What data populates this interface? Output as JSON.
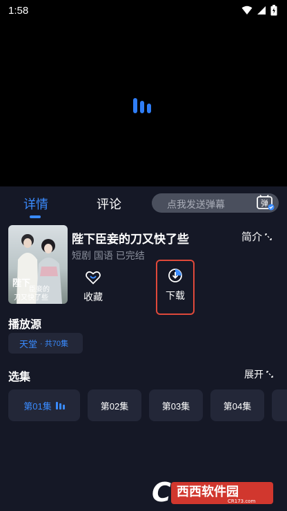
{
  "status_bar": {
    "time": "1:58"
  },
  "tabs": [
    {
      "label": "详情",
      "active": true
    },
    {
      "label": "评论",
      "active": false
    }
  ],
  "danmaku": {
    "placeholder": "点我发送弹幕",
    "icon_text": "弹"
  },
  "drama": {
    "title": "陛下臣妾的刀又快了些",
    "tags": "短剧 国语 已完结",
    "intro_label": "简介",
    "poster_text": "陛下 臣妾的 刀又快了些"
  },
  "actions": {
    "favorite_label": "收藏",
    "download_label": "下载"
  },
  "source": {
    "section_title": "播放源",
    "name": "天堂",
    "count": "· 共70集"
  },
  "episodes": {
    "section_title": "选集",
    "expand_label": "展开",
    "items": [
      "第01集",
      "第02集",
      "第03集",
      "第04集"
    ]
  },
  "watermark": {
    "brand": "西西软件园",
    "domain": "CR173.com"
  },
  "colors": {
    "accent": "#3a8bff",
    "panel_bg": "#151826",
    "highlight_border": "#e0493a"
  }
}
